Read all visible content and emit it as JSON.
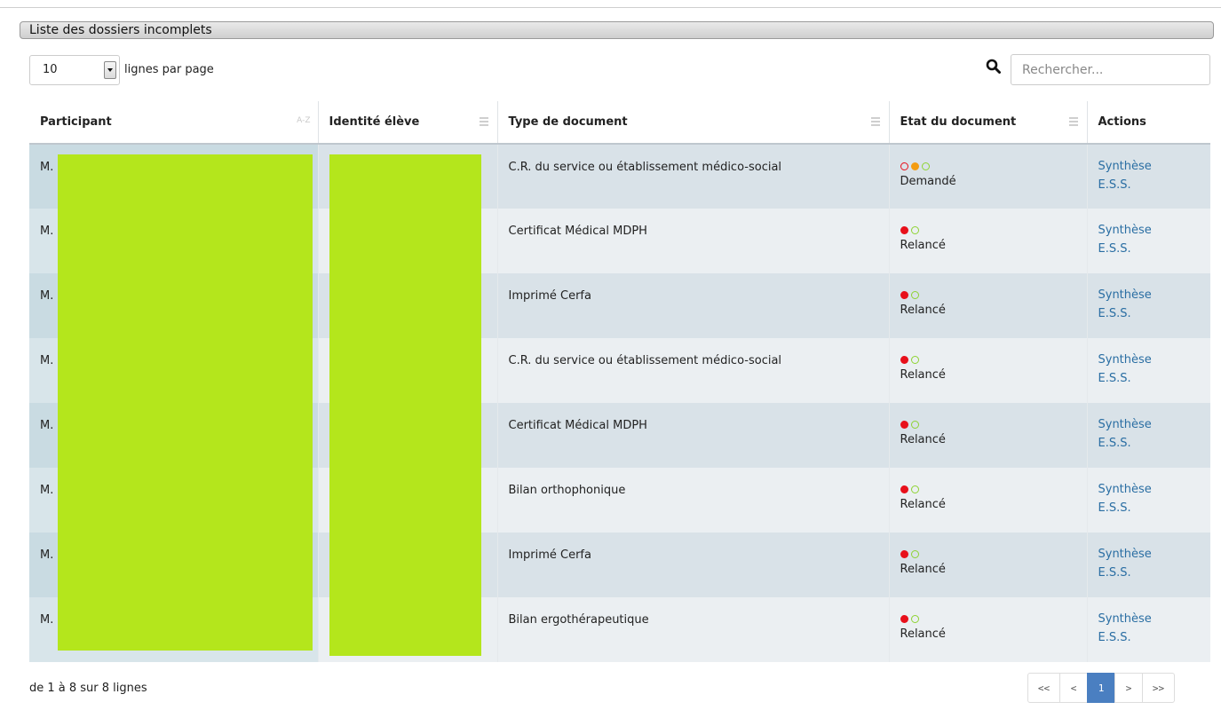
{
  "panel": {
    "title": "Liste des dossiers incomplets"
  },
  "length": {
    "value": "10",
    "label": "lignes par page"
  },
  "search": {
    "placeholder": "Rechercher..."
  },
  "columns": {
    "participant": "Participant",
    "participant_sort": "A-Z",
    "identite": "Identité élève",
    "type": "Type de document",
    "etat": "Etat du document",
    "actions": "Actions"
  },
  "state_colors": {
    "red": "#e8101b",
    "orange": "#f39c12",
    "green": "#8ed332"
  },
  "rows": [
    {
      "participant": "M.",
      "type": "C.R. du service ou établissement médico-social",
      "dots": [
        "red-outline",
        "orange",
        "green-outline"
      ],
      "state": "Demandé",
      "action1": "Synthèse",
      "action2": "E.S.S."
    },
    {
      "participant": "M.",
      "type": "Certificat Médical MDPH",
      "dots": [
        "red",
        "green-outline"
      ],
      "state": "Relancé",
      "action1": "Synthèse",
      "action2": "E.S.S."
    },
    {
      "participant": "M.",
      "type": "Imprimé Cerfa",
      "dots": [
        "red",
        "green-outline"
      ],
      "state": "Relancé",
      "action1": "Synthèse",
      "action2": "E.S.S."
    },
    {
      "participant": "M.",
      "type": "C.R. du service ou établissement médico-social",
      "dots": [
        "red",
        "green-outline"
      ],
      "state": "Relancé",
      "action1": "Synthèse",
      "action2": "E.S.S."
    },
    {
      "participant": "M.",
      "type": "Certificat Médical MDPH",
      "dots": [
        "red",
        "green-outline"
      ],
      "state": "Relancé",
      "action1": "Synthèse",
      "action2": "E.S.S."
    },
    {
      "participant": "M.",
      "type": "Bilan orthophonique",
      "dots": [
        "red",
        "green-outline"
      ],
      "state": "Relancé",
      "action1": "Synthèse",
      "action2": "E.S.S."
    },
    {
      "participant": "M.",
      "type": "Imprimé Cerfa",
      "dots": [
        "red",
        "green-outline"
      ],
      "state": "Relancé",
      "action1": "Synthèse",
      "action2": "E.S.S."
    },
    {
      "participant": "M.",
      "type": "Bilan ergothérapeutique",
      "dots": [
        "red",
        "green-outline"
      ],
      "state": "Relancé",
      "action1": "Synthèse",
      "action2": "E.S.S."
    }
  ],
  "footer": {
    "info": "de 1 à 8 sur 8 lignes"
  },
  "pager": {
    "first": "<<",
    "prev": "<",
    "current": "1",
    "next": ">",
    "last": ">>"
  }
}
